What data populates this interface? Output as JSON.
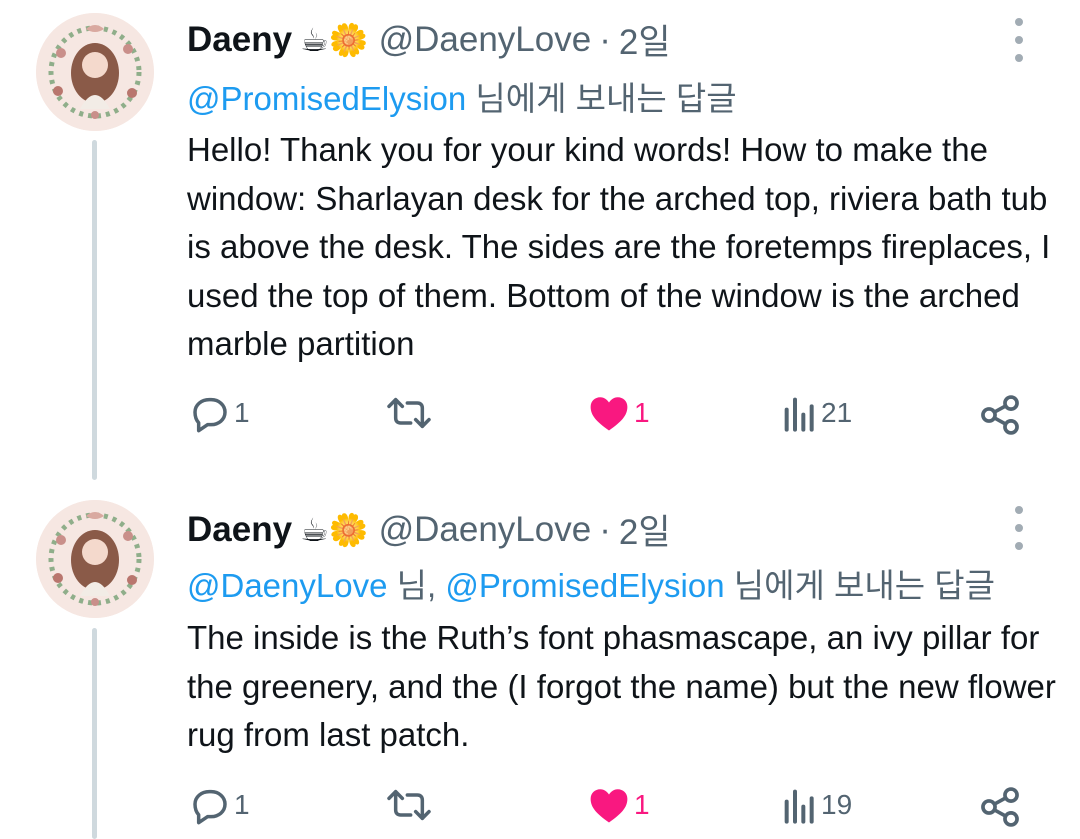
{
  "tweets": [
    {
      "author_name": "Daeny",
      "author_emoji": "☕🌼",
      "handle": "@DaenyLove",
      "separator": "·",
      "time": "2일",
      "replying_to": [
        {
          "mention": "@PromisedElysion",
          "suffix": " 님에게 보내는 답글"
        }
      ],
      "text": "Hello! Thank you for your kind words! How to make the window: Sharlayan desk for the arched top, riviera bath tub is  above the desk. The sides are the foretemps fireplaces, I used the top of them. Bottom of the window is the arched marble partition",
      "reply_count": "1",
      "retweet_count": "",
      "like_count": "1",
      "view_count": "21",
      "liked": true
    },
    {
      "author_name": "Daeny",
      "author_emoji": "☕🌼",
      "handle": "@DaenyLove",
      "separator": "·",
      "time": "2일",
      "replying_to": [
        {
          "mention": "@DaenyLove",
          "suffix": " 님, "
        },
        {
          "mention": "@PromisedElysion",
          "suffix": " 님에게 보내는 답글"
        }
      ],
      "text": "The inside is the Ruth’s font phasmascape, an ivy pillar for the greenery, and the (I forgot the name) but the new flower rug from last patch.",
      "reply_count": "1",
      "retweet_count": "",
      "like_count": "1",
      "view_count": "19",
      "liked": true
    }
  ],
  "icons": {
    "reply": "reply-icon",
    "retweet": "retweet-icon",
    "like": "heart-icon",
    "views": "views-icon",
    "share": "share-icon",
    "more": "more-vertical-icon"
  },
  "colors": {
    "link": "#1d9bf0",
    "like": "#f91880",
    "secondary": "#536471",
    "thread_line": "#cfd9de"
  }
}
